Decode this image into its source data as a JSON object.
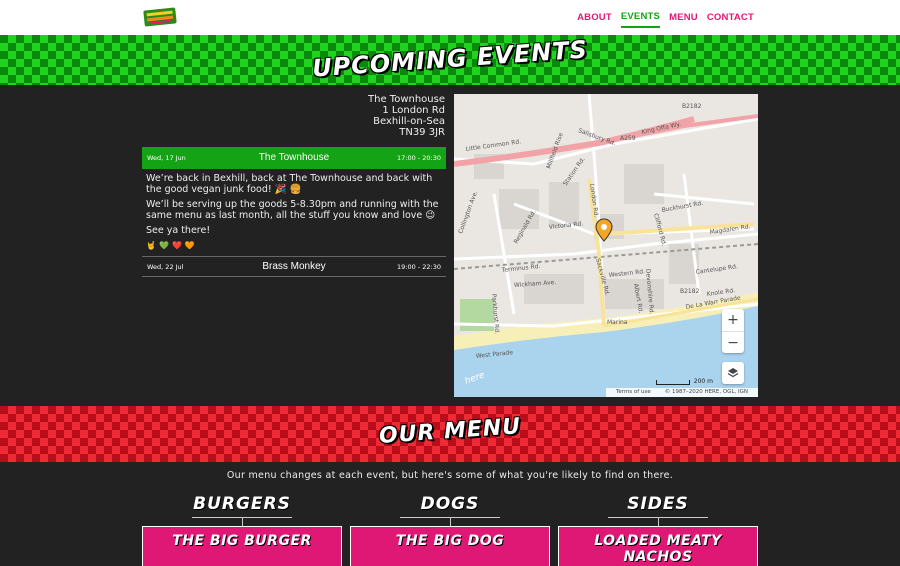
{
  "nav": {
    "links": [
      "ABOUT",
      "EVENTS",
      "MENU",
      "CONTACT"
    ],
    "active": "EVENTS"
  },
  "events_heading": "Upcoming Events",
  "venue_address": [
    "The Townhouse",
    "1 London Rd",
    "Bexhill-on-Sea",
    "TN39 3JR"
  ],
  "events": [
    {
      "date": "Wed, 17 Jun",
      "name": "The Townhouse",
      "time": "17:00 - 20:30",
      "description": [
        "We’re back in Bexhill, back at The Townhouse and back with the good vegan junk food! 🎉 🍔",
        "We’ll be serving up the goods 5-8.30pm and running with the same menu as last month, all the stuff you know and love 😉",
        "See ya there!"
      ],
      "emojis": [
        "🤘",
        "💚",
        "❤️",
        "🧡"
      ]
    },
    {
      "date": "Wed, 22 Jul",
      "name": "Brass Monkey",
      "time": "19:00 - 22:30"
    }
  ],
  "map": {
    "labels": [
      "King Offa Wy.",
      "Little Common Rd.",
      "Salisbury Rd.",
      "London Rd.",
      "Buckhurst Rd.",
      "Magdalen Rd.",
      "Victoria Rd.",
      "Terminus Rd.",
      "Wickham Ave.",
      "Sackville Rd.",
      "Western Rd.",
      "Marina",
      "West Parade",
      "De La Warr Parade",
      "Collington Ave.",
      "Clifford Rd.",
      "Cantelupe Rd.",
      "Devonshire Rd.",
      "Albert Rd.",
      "Knole Rd.",
      "Millfield Rise",
      "A259",
      "B2182",
      "B2182",
      "Parkhurst Rd.",
      "Station Rd.",
      "Reginald Rd."
    ],
    "zoom_in": "+",
    "zoom_out": "−",
    "scale": "200 m",
    "terms": "Terms of use",
    "copyright": "© 1987–2020 HERE, OGL, IGN",
    "watermark": "here"
  },
  "menu_heading": "Our Menu",
  "menu_intro": "Our menu changes at each event, but here's some of what you're likely to find on there.",
  "menu_columns": [
    {
      "title": "Burgers",
      "item": "The Big Burger"
    },
    {
      "title": "Dogs",
      "item": "The Big Dog"
    },
    {
      "title": "Sides",
      "item": "Loaded Meaty Nachos"
    }
  ],
  "colors": {
    "accent_pink": "#e01875",
    "accent_green": "#14a314",
    "checker_red": "#f02a35",
    "checker_green": "#1fd31f",
    "background": "#222222"
  },
  "icons": {
    "logo": "logo-icon",
    "map_marker": "map-marker-icon",
    "layers": "layers-icon"
  }
}
